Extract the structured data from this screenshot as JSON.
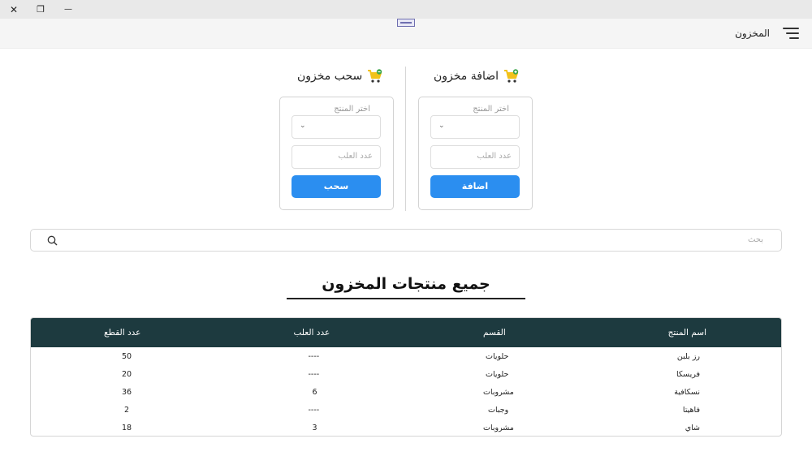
{
  "window": {
    "close_glyph": "✕",
    "restore_glyph": "❐",
    "minimize_glyph": "—"
  },
  "appbar": {
    "title": "المخزون",
    "menu_icon": "hamburger-icon"
  },
  "add_panel": {
    "title": "اضافة مخزون",
    "icon": "cart-plus-icon",
    "select_label": "اختر المنتج",
    "count_placeholder": "عدد العلب",
    "button_label": "اضافة"
  },
  "withdraw_panel": {
    "title": "سحب مخزون",
    "icon": "cart-minus-icon",
    "select_label": "اختر المنتج",
    "count_placeholder": "عدد العلب",
    "button_label": "سحب"
  },
  "search": {
    "placeholder": "بحث",
    "icon": "search-icon"
  },
  "section_title": "جميع منتجات المخزون",
  "table": {
    "headers": [
      "اسم المنتج",
      "القسم",
      "عدد العلب",
      "عدد القطع"
    ],
    "rows": [
      [
        "رز بلبن",
        "حلويات",
        "----",
        "50"
      ],
      [
        "فريسكا",
        "حلويات",
        "----",
        "20"
      ],
      [
        "نسكافية",
        "مشروبات",
        "6",
        "36"
      ],
      [
        "فاهيتا",
        "وجبات",
        "----",
        "2"
      ],
      [
        "شاي",
        "مشروبات",
        "3",
        "18"
      ]
    ]
  },
  "colors": {
    "accent": "#2b8ef0",
    "table_header": "#1d3a3f",
    "cart_green": "#3aa64a",
    "cart_yellow": "#f2c21b"
  }
}
